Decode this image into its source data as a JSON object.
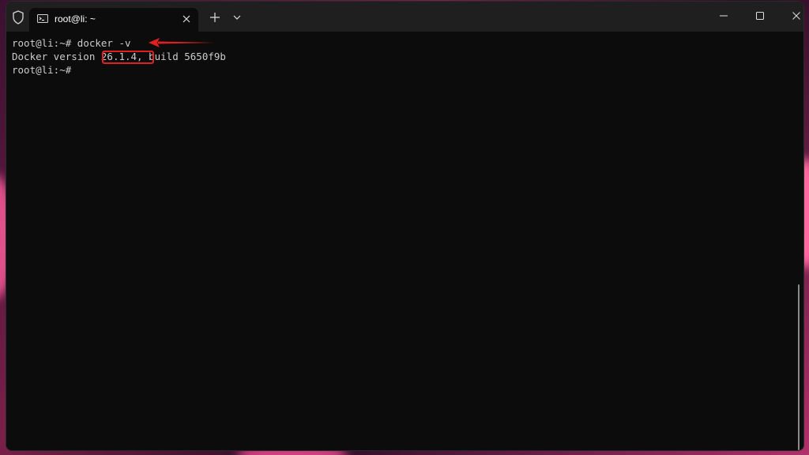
{
  "tab": {
    "title": "root@li: ~"
  },
  "terminal": {
    "lines": [
      {
        "prompt": "root@li:~#",
        "command": " docker -v"
      },
      {
        "prefix": "Docker version ",
        "version": "26.1.4,",
        "suffix": " build 5650f9b"
      },
      {
        "prompt": "root@li:~#",
        "command": ""
      }
    ]
  },
  "icons": {
    "shield": "shield-icon",
    "tab": "terminal-icon",
    "close_tab": "close-icon",
    "new_tab": "plus-icon",
    "dropdown": "chevron-down-icon",
    "minimize": "minimize-icon",
    "maximize": "maximize-icon",
    "close": "close-window-icon"
  },
  "colors": {
    "annotation": "#e02020",
    "terminal_bg": "#0c0c0c",
    "terminal_text": "#cccccc",
    "titlebar_bg": "#1f1f1f"
  }
}
